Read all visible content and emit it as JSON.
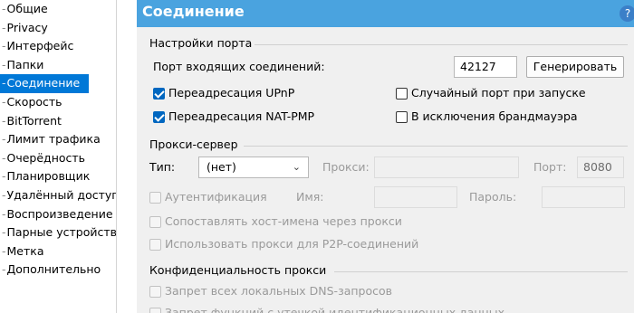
{
  "sidebar": {
    "items": [
      {
        "label": "Общие",
        "selected": false
      },
      {
        "label": "Privacy",
        "selected": false
      },
      {
        "label": "Интерфейс",
        "selected": false
      },
      {
        "label": "Папки",
        "selected": false
      },
      {
        "label": "Соединение",
        "selected": true
      },
      {
        "label": "Скорость",
        "selected": false
      },
      {
        "label": "BitTorrent",
        "selected": false
      },
      {
        "label": "Лимит трафика",
        "selected": false
      },
      {
        "label": "Очерёдность",
        "selected": false
      },
      {
        "label": "Планировщик",
        "selected": false
      },
      {
        "label": "Удалённый доступ",
        "selected": false
      },
      {
        "label": "Воспроизведение",
        "selected": false
      },
      {
        "label": "Парные устройства",
        "selected": false
      },
      {
        "label": "Метка",
        "selected": false
      },
      {
        "label": "Дополнительно",
        "selected": false
      }
    ]
  },
  "header": {
    "title": "Соединение",
    "help_icon": "question-mark-icon",
    "color": "#4aa3df"
  },
  "port_settings": {
    "title": "Настройки порта",
    "incoming_label": "Порт входящих соединений:",
    "port_value": "42127",
    "generate_label": "Генерировать",
    "upnp_label": "Переадресация UPnP",
    "upnp_checked": true,
    "natpmp_label": "Переадресация NAT-PMP",
    "natpmp_checked": true,
    "random_port_label": "Случайный порт при запуске",
    "random_port_checked": false,
    "firewall_label": "В исключения брандмауэра",
    "firewall_checked": false
  },
  "proxy": {
    "title": "Прокси-сервер",
    "type_label": "Тип:",
    "type_value": "(нет)",
    "proxy_label": "Прокси:",
    "proxy_value": "",
    "port_label": "Порт:",
    "port_value": "8080",
    "auth_label": "Аутентификация",
    "name_label": "Имя:",
    "password_label": "Пароль:",
    "resolve_label": "Сопоставлять хост-имена через прокси",
    "p2p_label": "Использовать прокси для P2P-соединений"
  },
  "privacy": {
    "title": "Конфиденциальность прокси",
    "dns_label": "Запрет всех локальных DNS-запросов",
    "leak_label": "Запрет функций с утечкой идентификационных данных"
  },
  "colors": {
    "accent": "#0078d7",
    "checkbox": "#0067c0"
  }
}
